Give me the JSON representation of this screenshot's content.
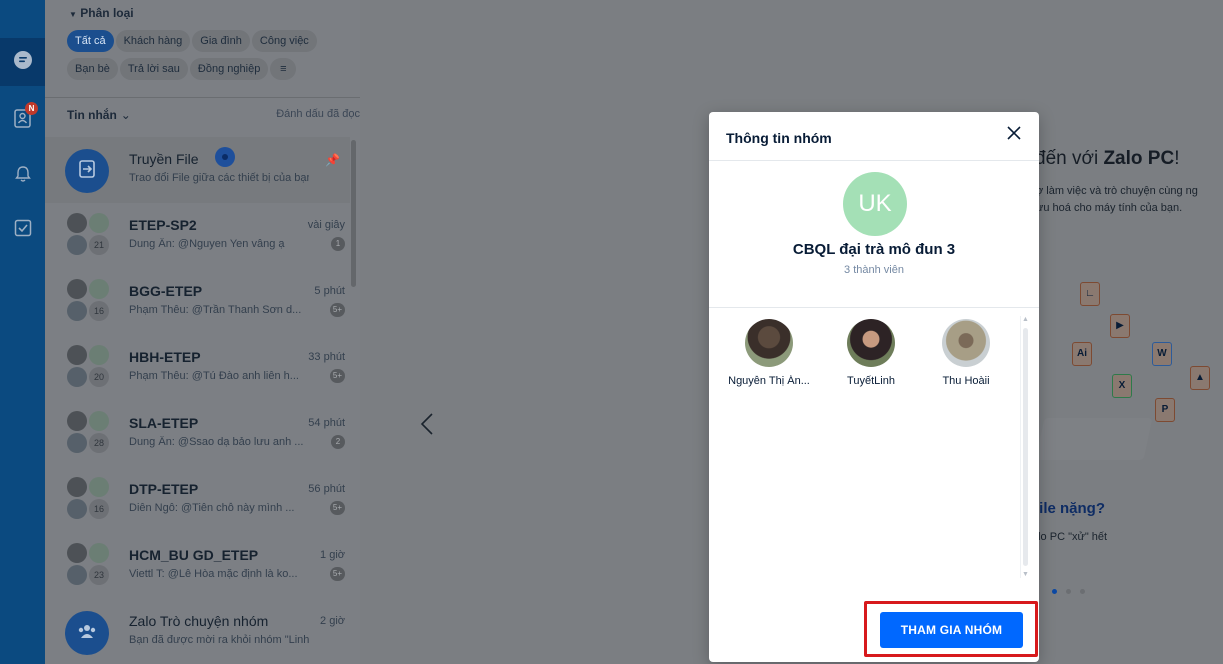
{
  "nav_rail": {
    "items": [
      {
        "icon": "chat-icon",
        "active": true
      },
      {
        "icon": "contacts-icon",
        "badge": "N"
      },
      {
        "icon": "bell-icon"
      },
      {
        "icon": "todo-checkbox-icon"
      }
    ]
  },
  "categories": {
    "header": "Phân loại",
    "chips": [
      "Tất cả",
      "Khách hàng",
      "Gia đình",
      "Công việc",
      "Bạn bè",
      "Trả lời sau",
      "Đồng nghiệp"
    ],
    "active_chip": "Tất cả"
  },
  "messages_header": {
    "label": "Tin nhắn",
    "mark_read": "Đánh dấu đã đọc"
  },
  "conversations": [
    {
      "name": "Truyền File",
      "preview": "Trao đổi File giữa các thiết bị của bạn",
      "time": "",
      "badge": "",
      "pinned": true,
      "member_count": ""
    },
    {
      "name": "ETEP-SP2",
      "preview": "Dung Ân: @Nguyen Yen vâng ạ",
      "time": "vài giây",
      "badge": "1",
      "member_count": "21"
    },
    {
      "name": "BGG-ETEP",
      "preview": "Phạm Thêu: @Trần Thanh Sơn d...",
      "time": "5 phút",
      "badge": "5+",
      "member_count": "16"
    },
    {
      "name": "HBH-ETEP",
      "preview": "Phạm Thêu: @Tú Đào anh liên h...",
      "time": "33 phút",
      "badge": "5+",
      "member_count": "20"
    },
    {
      "name": "SLA-ETEP",
      "preview": "Dung Ân: @Ssao dạ bảo lưu anh ...",
      "time": "54 phút",
      "badge": "2",
      "member_count": "28"
    },
    {
      "name": "DTP-ETEP",
      "preview": "Diên Ngô: @Tiên chỗ này mình ...",
      "time": "56 phút",
      "badge": "5+",
      "member_count": "16"
    },
    {
      "name": "HCM_BU GD_ETEP",
      "preview": "Viettl T: @Lê Hòa mặc định là ko...",
      "time": "1 giờ",
      "badge": "5+",
      "member_count": "23"
    },
    {
      "name": "Zalo Trò chuyện nhóm",
      "preview": "Bạn đã được mời ra khỏi nhóm \"Linh...",
      "time": "2 giờ",
      "badge": "",
      "member_count": ""
    }
  ],
  "welcome": {
    "title_prefix": "đến với ",
    "title_brand": "Zalo PC",
    "title_suffix": "!",
    "text_line1": "ợ làm việc và trò chuyện cùng ng",
    "text_line2": "ưu hoá cho máy tính của bạn.",
    "feature_title": "File nặng?",
    "feature_text": "alo PC \"xử\" hết",
    "file_labels": [
      "Ai",
      "W",
      "X",
      "P"
    ]
  },
  "modal": {
    "title": "Thông tin nhóm",
    "avatar_initials": "UK",
    "avatar_color": "#a4e0b6",
    "group_name": "CBQL đại trà mô đun 3",
    "member_count": "3 thành viên",
    "members": [
      {
        "name": "Nguyễn Thị Án..."
      },
      {
        "name": "TuyếtLinh"
      },
      {
        "name": "Thu Hoàii"
      }
    ],
    "join_button": "THAM GIA NHÓM",
    "accent_color": "#0068ff",
    "highlight_color": "#d7191c"
  }
}
